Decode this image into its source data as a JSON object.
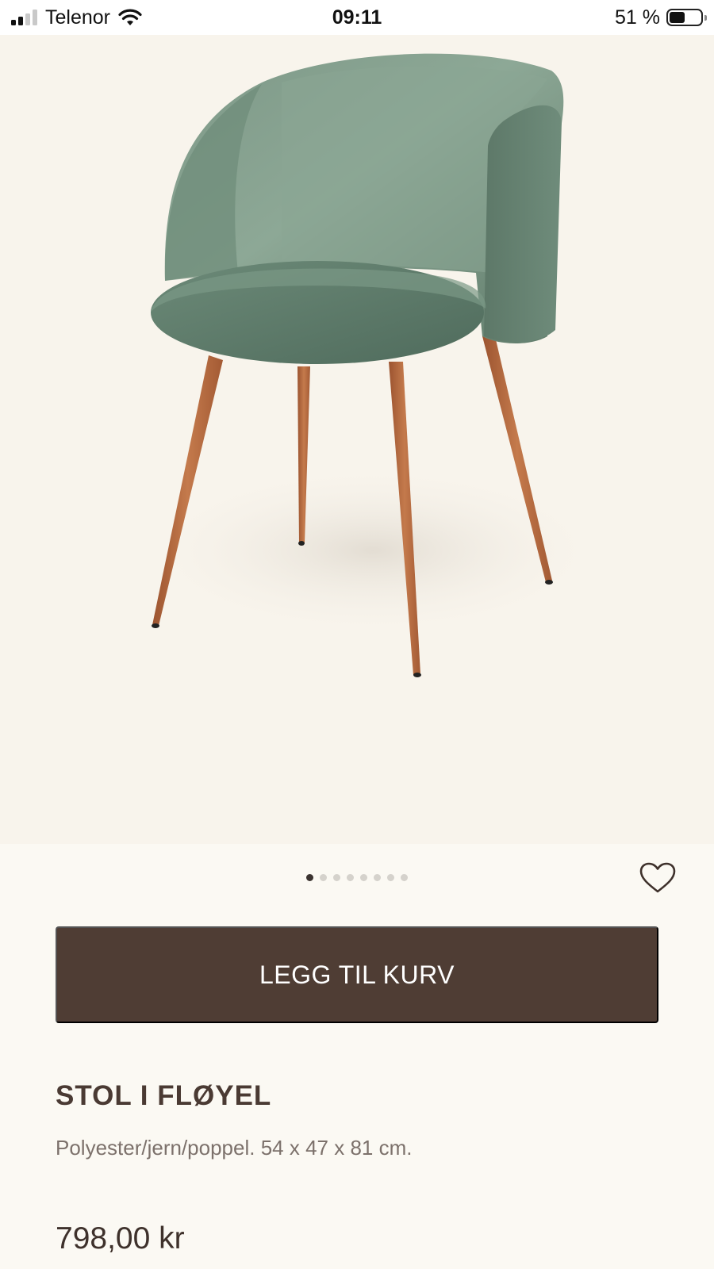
{
  "status_bar": {
    "carrier": "Telenor",
    "time": "09:11",
    "battery_text": "51 %",
    "battery_level": 0.51
  },
  "product_image": {
    "icon": "product-photo-chair"
  },
  "gallery": {
    "total_images": 8,
    "active_index": 0
  },
  "favorite": {
    "icon": "heart-icon"
  },
  "actions": {
    "add_to_cart": "LEGG TIL KURV"
  },
  "product": {
    "title": "STOL I FLØYEL",
    "description": "Polyester/jern/poppel. 54 x 47 x 81 cm.",
    "price": "798,00 kr"
  },
  "colors": {
    "button": "#4f3d34",
    "page_bg": "#fbf9f3",
    "image_bg": "#f8f4ec",
    "velvet": "#6b8a78",
    "wood": "#b8693e"
  }
}
